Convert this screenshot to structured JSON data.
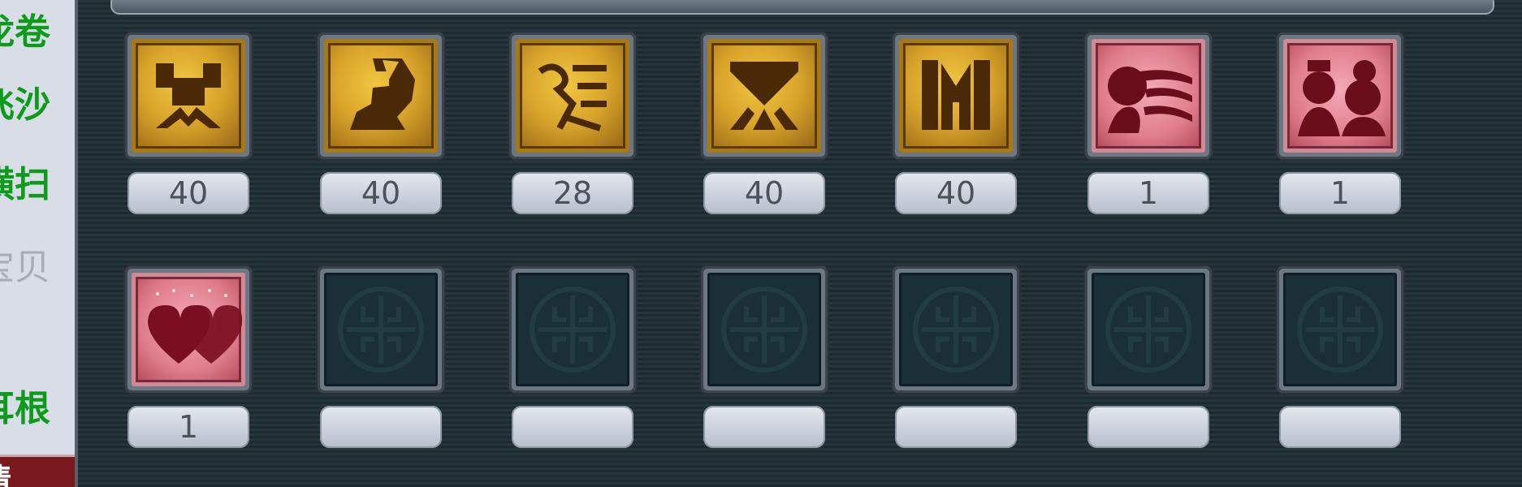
{
  "left_panel": {
    "items": [
      {
        "label": "龙卷",
        "style": "green"
      },
      {
        "label": "飞沙",
        "style": "green"
      },
      {
        "label": "横扫",
        "style": "green"
      },
      {
        "label": "宝贝",
        "style": "grey"
      },
      {
        "label": "耳根",
        "style": "green"
      }
    ],
    "apply_label": "请"
  },
  "inventory": {
    "slots": [
      {
        "icon": "gold-rune-crab-icon",
        "kind": "gold",
        "count": "40"
      },
      {
        "icon": "gold-rune-fist-icon",
        "kind": "gold",
        "count": "40"
      },
      {
        "icon": "gold-rune-runner-icon",
        "kind": "gold",
        "count": "28"
      },
      {
        "icon": "gold-rune-figure-icon",
        "kind": "gold",
        "count": "40"
      },
      {
        "icon": "gold-rune-gate-icon",
        "kind": "gold",
        "count": "40"
      },
      {
        "icon": "pink-portrait-woman-icon",
        "kind": "pink",
        "count": "1"
      },
      {
        "icon": "pink-couple-icon",
        "kind": "pink",
        "count": "1"
      },
      {
        "icon": "pink-hearts-icon",
        "kind": "pink",
        "count": "1"
      },
      {
        "icon": "empty-slot-icon",
        "kind": "empty",
        "count": ""
      },
      {
        "icon": "empty-slot-icon",
        "kind": "empty",
        "count": ""
      },
      {
        "icon": "empty-slot-icon",
        "kind": "empty",
        "count": ""
      },
      {
        "icon": "empty-slot-icon",
        "kind": "empty",
        "count": ""
      },
      {
        "icon": "empty-slot-icon",
        "kind": "empty",
        "count": ""
      },
      {
        "icon": "empty-slot-icon",
        "kind": "empty",
        "count": ""
      }
    ]
  },
  "scrollbar": {
    "up_icon": "triangle-up-icon",
    "down_icon": "triangle-down-icon",
    "up_glyph": "▲",
    "down_glyph": "▼"
  },
  "colors": {
    "skill_green": "#0e9a1a",
    "panel_dark": "#1c2a30",
    "gold": "#d8a32a",
    "pink": "#e07d8c"
  }
}
